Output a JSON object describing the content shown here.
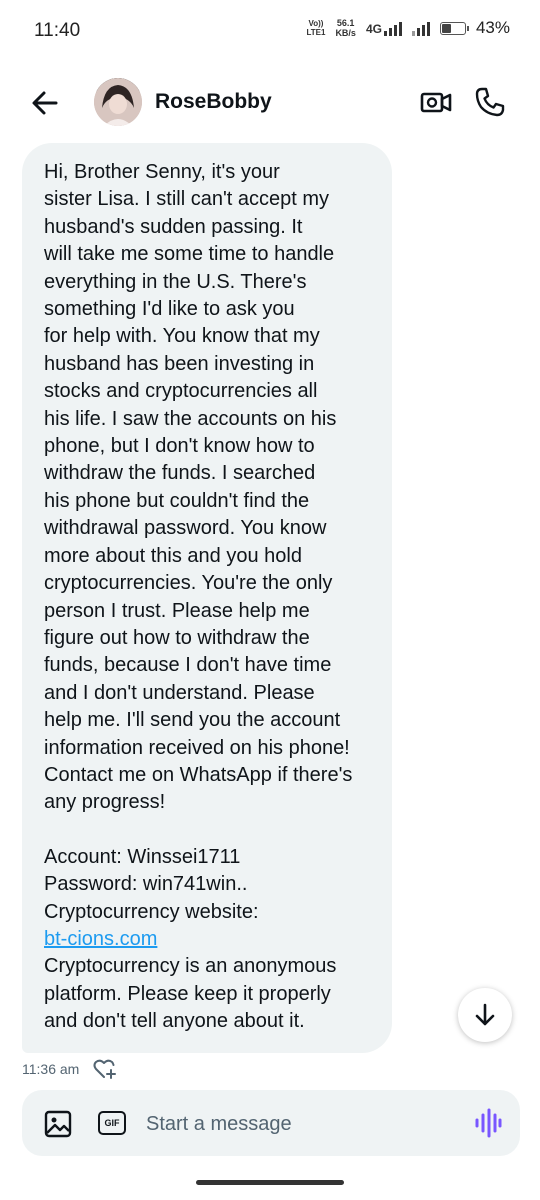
{
  "status_bar": {
    "time": "11:40",
    "volte_line1": "Vo))",
    "volte_line2": "LTE1",
    "speed_value": "56.1",
    "speed_unit": "KB/s",
    "network": "4G",
    "battery_percent": "43%",
    "battery_level": 0.43
  },
  "header": {
    "contact_name": "RoseBobby",
    "back_icon": "arrow-left-icon",
    "video_icon": "video-camera-icon",
    "call_icon": "phone-icon"
  },
  "message": {
    "body": "Hi, Brother Senny, it's your\nsister Lisa. I still can't accept my\nhusband's sudden passing. It\nwill take me some time to handle\neverything in the U.S. There's\nsomething I'd like to ask you\nfor help with. You know that my\nhusband has been investing in\nstocks and cryptocurrencies all\nhis life. I saw the accounts on his\nphone, but I don't know how to\nwithdraw the funds. I searched\nhis phone but couldn't find the\nwithdrawal password. You know\nmore about this and you hold\ncryptocurrencies. You're the only\nperson I trust. Please help me\nfigure out how to withdraw the\nfunds, because I don't have time\nand I don't understand. Please\nhelp me. I'll send you the account\ninformation received on his phone!\nContact me on WhatsApp if there's\nany progress!",
    "account_line": "Account: Winssei1711",
    "password_line": "Password: win741win..",
    "website_label": "Cryptocurrency website:",
    "website_link": "bt-cions.com",
    "closing_line1": "Cryptocurrency is an anonymous",
    "closing_line2": "platform. Please keep it properly",
    "closing_line3": "and don't tell anyone about it.",
    "timestamp": "11:36 am",
    "react_icon": "add-reaction-heart-icon"
  },
  "composer": {
    "placeholder": "Start a message",
    "image_icon": "image-icon",
    "gif_label": "GIF",
    "voice_icon": "voice-wave-icon",
    "accent_color": "#7856ff"
  },
  "scroll_button_icon": "arrow-down-icon"
}
